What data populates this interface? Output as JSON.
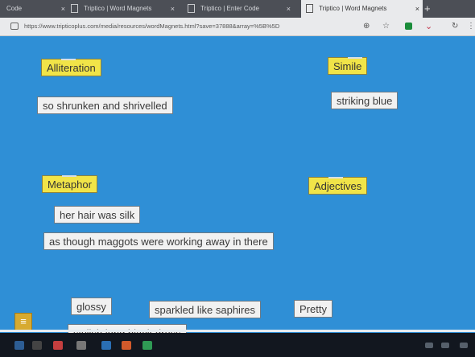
{
  "browser": {
    "tabs": [
      {
        "label": "Code",
        "active": false
      },
      {
        "label": "Triptico | Word Magnets",
        "active": false
      },
      {
        "label": "Triptico | Enter Code",
        "active": false
      },
      {
        "label": "Triptico | Word Magnets",
        "active": true
      }
    ],
    "new_tab": "+",
    "url": "https://www.tripticoplus.com/media/resources/wordMagnets.html?save=37888&array=%5B%5D"
  },
  "board": {
    "headings": [
      {
        "label": "Alliteration"
      },
      {
        "label": "Simile"
      },
      {
        "label": "Metaphor"
      },
      {
        "label": "Adjectives"
      }
    ],
    "magnets": [
      {
        "label": "so shrunken and shrivelled"
      },
      {
        "label": "striking blue"
      },
      {
        "label": "her hair was silk"
      },
      {
        "label": "as though maggots were working away in there"
      },
      {
        "label": "glossy"
      },
      {
        "label": "sparkled like saphires"
      },
      {
        "label": "Pretty"
      },
      {
        "label": "stylish long black dress"
      }
    ]
  },
  "colors": {
    "board": "#2f8fd6",
    "heading": "#f1e448",
    "magnet": "#f1f1f1",
    "menu": "#d7aa30"
  }
}
